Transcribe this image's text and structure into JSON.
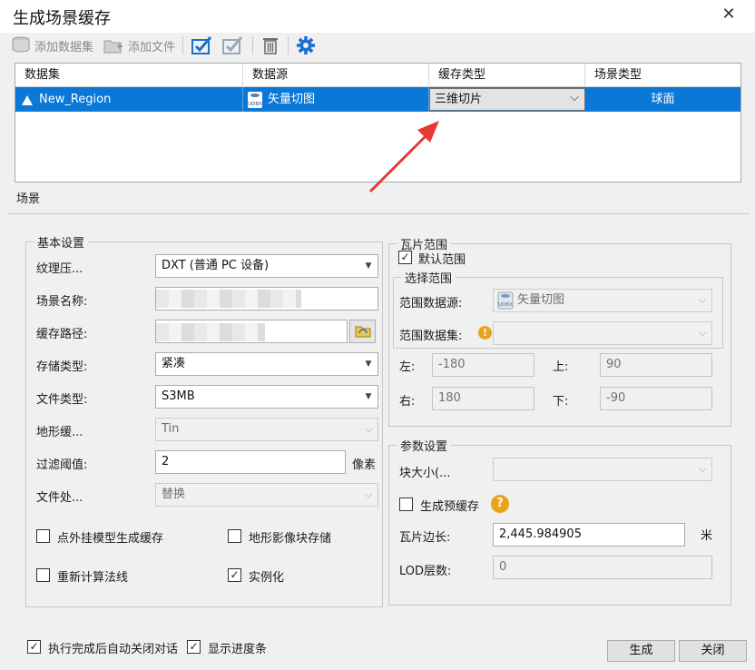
{
  "window": {
    "title": "生成场景缓存",
    "close_glyph": "✕"
  },
  "toolbar": {
    "add_dataset": "添加数据集",
    "add_file": "添加文件"
  },
  "grid": {
    "columns": [
      "数据集",
      "数据源",
      "缓存类型",
      "场景类型"
    ],
    "row": {
      "dataset": "New_Region",
      "datasource": "矢量切图",
      "cache_type": "三维切片",
      "scene_type": "球面"
    }
  },
  "tab": {
    "label": "场景"
  },
  "basic": {
    "legend": "基本设置",
    "texture_label": "纹理压...",
    "texture_value": "DXT (普通 PC 设备)",
    "scene_name_label": "场景名称:",
    "cache_path_label": "缓存路径:",
    "storage_label": "存储类型:",
    "storage_value": "紧凑",
    "file_type_label": "文件类型:",
    "file_type_value": "S3MB",
    "terrain_label": "地形缓...",
    "terrain_value": "Tin",
    "filter_label": "过滤阈值:",
    "filter_value": "2",
    "filter_unit": "像素",
    "file_proc_label": "文件处...",
    "file_proc_value": "替换",
    "opt_point_model": "点外挂模型生成缓存",
    "opt_terrain_block": "地形影像块存储",
    "opt_recalc_normal": "重新计算法线",
    "opt_instancing": "实例化"
  },
  "tile": {
    "legend": "瓦片范围",
    "default_extent": "默认范围",
    "select_legend": "选择范围",
    "range_ds_label": "范围数据源:",
    "range_ds_value": "矢量切图",
    "range_dset_label": "范围数据集:",
    "left_label": "左:",
    "left_value": "-180",
    "top_label": "上:",
    "top_value": "90",
    "right_label": "右:",
    "right_value": "180",
    "bottom_label": "下:",
    "bottom_value": "-90"
  },
  "params": {
    "legend": "参数设置",
    "block_size_label": "块大小(...",
    "gen_precache": "生成预缓存",
    "tile_edge_label": "瓦片边长:",
    "tile_edge_value": "2,445.984905",
    "tile_edge_unit": "米",
    "lod_label": "LOD层数:",
    "lod_value": "0"
  },
  "footer": {
    "auto_close": "执行完成后自动关闭对话",
    "show_progress": "显示进度条",
    "generate": "生成",
    "close": "关闭"
  },
  "glyphs": {
    "check": "✓",
    "dropdown": "▼",
    "chevron": "⌵",
    "help": "?",
    "warning": "!"
  },
  "colors": {
    "selection": "#0a78d7",
    "accent_blue": "#1e6fcf",
    "help_amber": "#e8a317",
    "annotation_arrow": "#e53935"
  }
}
